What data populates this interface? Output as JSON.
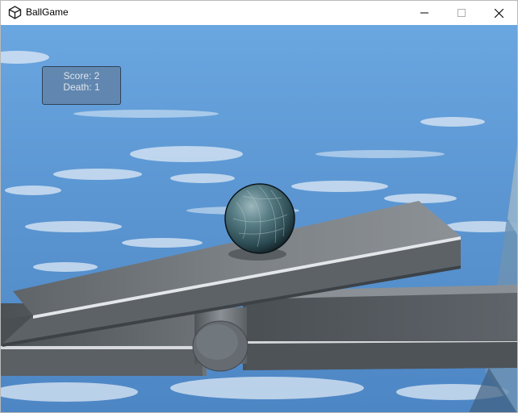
{
  "window": {
    "title": "BallGame"
  },
  "hud": {
    "score_label": "Score: 2",
    "death_label": "Death: 1"
  },
  "icons": {
    "app": "unity-logo-icon",
    "minimize": "minimize-icon",
    "maximize": "maximize-icon",
    "close": "close-icon"
  },
  "colors": {
    "sky": "#5f9ad6",
    "platform": "#7d8287",
    "ball": "#3f6a72"
  }
}
